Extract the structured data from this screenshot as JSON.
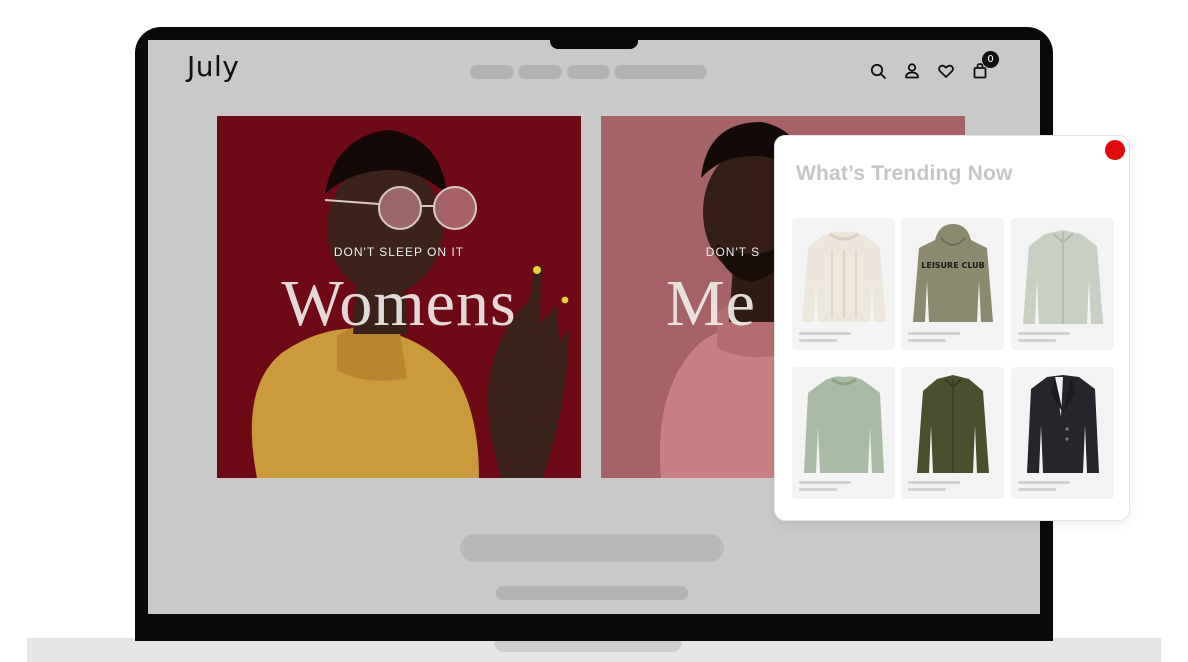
{
  "brand": {
    "logo_text": "July"
  },
  "header": {
    "cart_count": "0",
    "icons": [
      "search-icon",
      "account-icon",
      "wishlist-heart-icon",
      "cart-bag-icon"
    ]
  },
  "hero": {
    "women": {
      "eyebrow": "DON'T SLEEP ON IT",
      "title": "Womens",
      "background": "#6c0b16"
    },
    "men": {
      "eyebrow": "DON'T S",
      "title": "Me",
      "background": "#a76468"
    }
  },
  "trending": {
    "title": "What’s Trending Now",
    "close_color": "#e20b0b",
    "products": [
      {
        "name": "cream-cable-knit-sweater",
        "color": "#ece6dc"
      },
      {
        "name": "olive-leisure-club-hoodie",
        "color": "#8b8a6e",
        "print": "LEISURE CLUB"
      },
      {
        "name": "sage-shirt",
        "color": "#c8cfc3"
      },
      {
        "name": "mint-knit-sweater",
        "color": "#a9bba4"
      },
      {
        "name": "dark-olive-shirt",
        "color": "#48502d"
      },
      {
        "name": "black-blazer",
        "color": "#24262b"
      }
    ]
  }
}
